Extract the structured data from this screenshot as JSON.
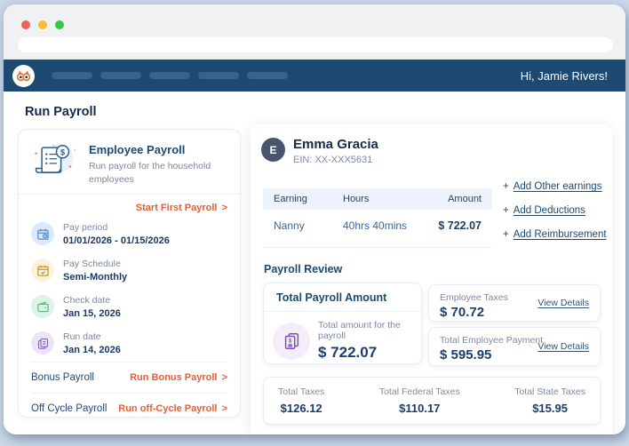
{
  "chars": {
    "chevron": ">",
    "plus": "+"
  },
  "browser": {
    "greeting": "Hi, Jamie Rivers!"
  },
  "page": {
    "title": "Run Payroll"
  },
  "left_card": {
    "title": "Employee Payroll",
    "description": "Run payroll for the household employees",
    "start_link": "Start First Payroll",
    "items": [
      {
        "icon": "calendar-period-icon",
        "label": "Pay period",
        "value": "01/01/2026 - 01/15/2026"
      },
      {
        "icon": "calendar-check-icon",
        "label": "Pay Schedule",
        "value": "Semi-Monthly"
      },
      {
        "icon": "wallet-icon",
        "label": "Check date",
        "value": "Jan 15, 2026"
      },
      {
        "icon": "documents-icon",
        "label": "Run date",
        "value": "Jan 14, 2026"
      }
    ],
    "bonus": {
      "label": "Bonus Payroll",
      "link": "Run Bonus Payroll"
    },
    "off_cycle": {
      "label": "Off Cycle Payroll",
      "link": "Run off-Cycle Payroll"
    }
  },
  "employee": {
    "initial": "E",
    "name": "Emma Gracia",
    "ein": "EIN: XX-XXX5631",
    "table": {
      "headers": [
        "Earning",
        "Hours",
        "Amount"
      ],
      "rows": [
        [
          "Nanny",
          "40hrs 40mins",
          "$ 722.07"
        ]
      ]
    },
    "links": [
      {
        "prefix": "+",
        "label": "Add Other earnings"
      },
      {
        "prefix": "+",
        "label": "Add Deductions"
      },
      {
        "prefix": "+",
        "label": "Add Reimbursement"
      }
    ]
  },
  "review": {
    "heading": "Payroll Review",
    "total_card": {
      "title": "Total Payroll Amount",
      "label": "Total amount for the payroll",
      "amount": "$ 722.07"
    },
    "side_cards": [
      {
        "label": "Employee Taxes",
        "amount": "$ 70.72",
        "link": "View Details"
      },
      {
        "label": "Total Employee Payment",
        "amount": "$ 595.95",
        "link": "View Details"
      }
    ],
    "totals": [
      {
        "label": "Total Taxes",
        "amount": "$126.12"
      },
      {
        "label": "Total Federal Taxes",
        "amount": "$110.17"
      },
      {
        "label": "Total State Taxes",
        "amount": "$15.95"
      }
    ]
  },
  "colors": {
    "navbar": "#1d4a73",
    "accent_orange": "#e55f38",
    "value_navy": "#1c3e6d",
    "muted_gray": "#7d89a3",
    "table_header_bg": "#ecf3fb",
    "frame_bg": "#c9d7e8"
  }
}
